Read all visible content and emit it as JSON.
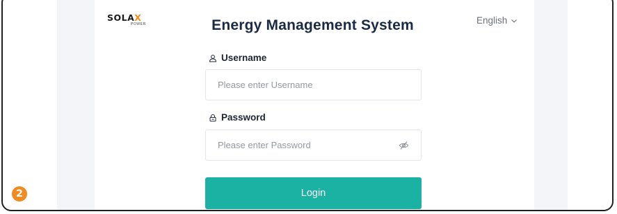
{
  "brand": {
    "logo_text_main": "SOLA",
    "logo_text_accent": "X",
    "logo_subtext": "POWER",
    "accent_color": "#f28c1b"
  },
  "header": {
    "title": "Energy Management System",
    "language": "English",
    "language_icon": "chevron-down-icon"
  },
  "form": {
    "username": {
      "label": "Username",
      "icon": "user-icon",
      "value": "",
      "placeholder": "Please enter Username"
    },
    "password": {
      "label": "Password",
      "icon": "lock-icon",
      "value": "",
      "placeholder": "Please enter Password",
      "toggle_icon": "eye-off-icon"
    },
    "login_label": "Login",
    "login_color": "#1bb2a3"
  },
  "annotation": {
    "step_number": "2",
    "color": "#f08a21"
  }
}
